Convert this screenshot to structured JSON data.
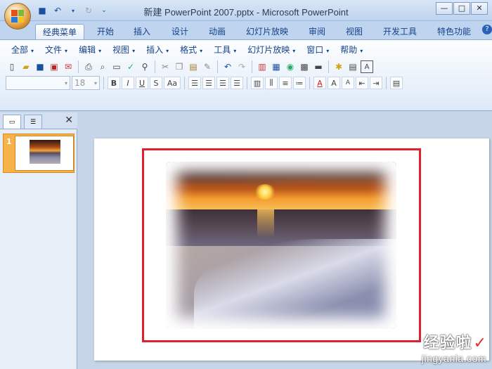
{
  "window": {
    "title": "新建 PowerPoint 2007.pptx - Microsoft PowerPoint",
    "controls": [
      "—",
      "□",
      "✕"
    ]
  },
  "tabs": [
    {
      "label": "经典菜单",
      "active": true
    },
    {
      "label": "开始"
    },
    {
      "label": "插入"
    },
    {
      "label": "设计"
    },
    {
      "label": "动画"
    },
    {
      "label": "幻灯片放映"
    },
    {
      "label": "审阅"
    },
    {
      "label": "视图"
    },
    {
      "label": "开发工具"
    },
    {
      "label": "特色功能"
    }
  ],
  "menus": [
    "全部",
    "文件",
    "编辑",
    "视图",
    "插入",
    "格式",
    "工具",
    "幻灯片放映",
    "窗口",
    "帮助"
  ],
  "format": {
    "font_size": "18",
    "bold": "B",
    "italic": "I",
    "underline": "U",
    "shadow": "S",
    "change_case": "Aa"
  },
  "side_panel": {
    "slide_number": "1"
  },
  "watermark": {
    "text": "经验啦",
    "url": "jingyanla.com"
  },
  "icons": [
    "office-button",
    "save-icon",
    "undo-icon",
    "redo-icon",
    "help-icon",
    "close-icon"
  ]
}
